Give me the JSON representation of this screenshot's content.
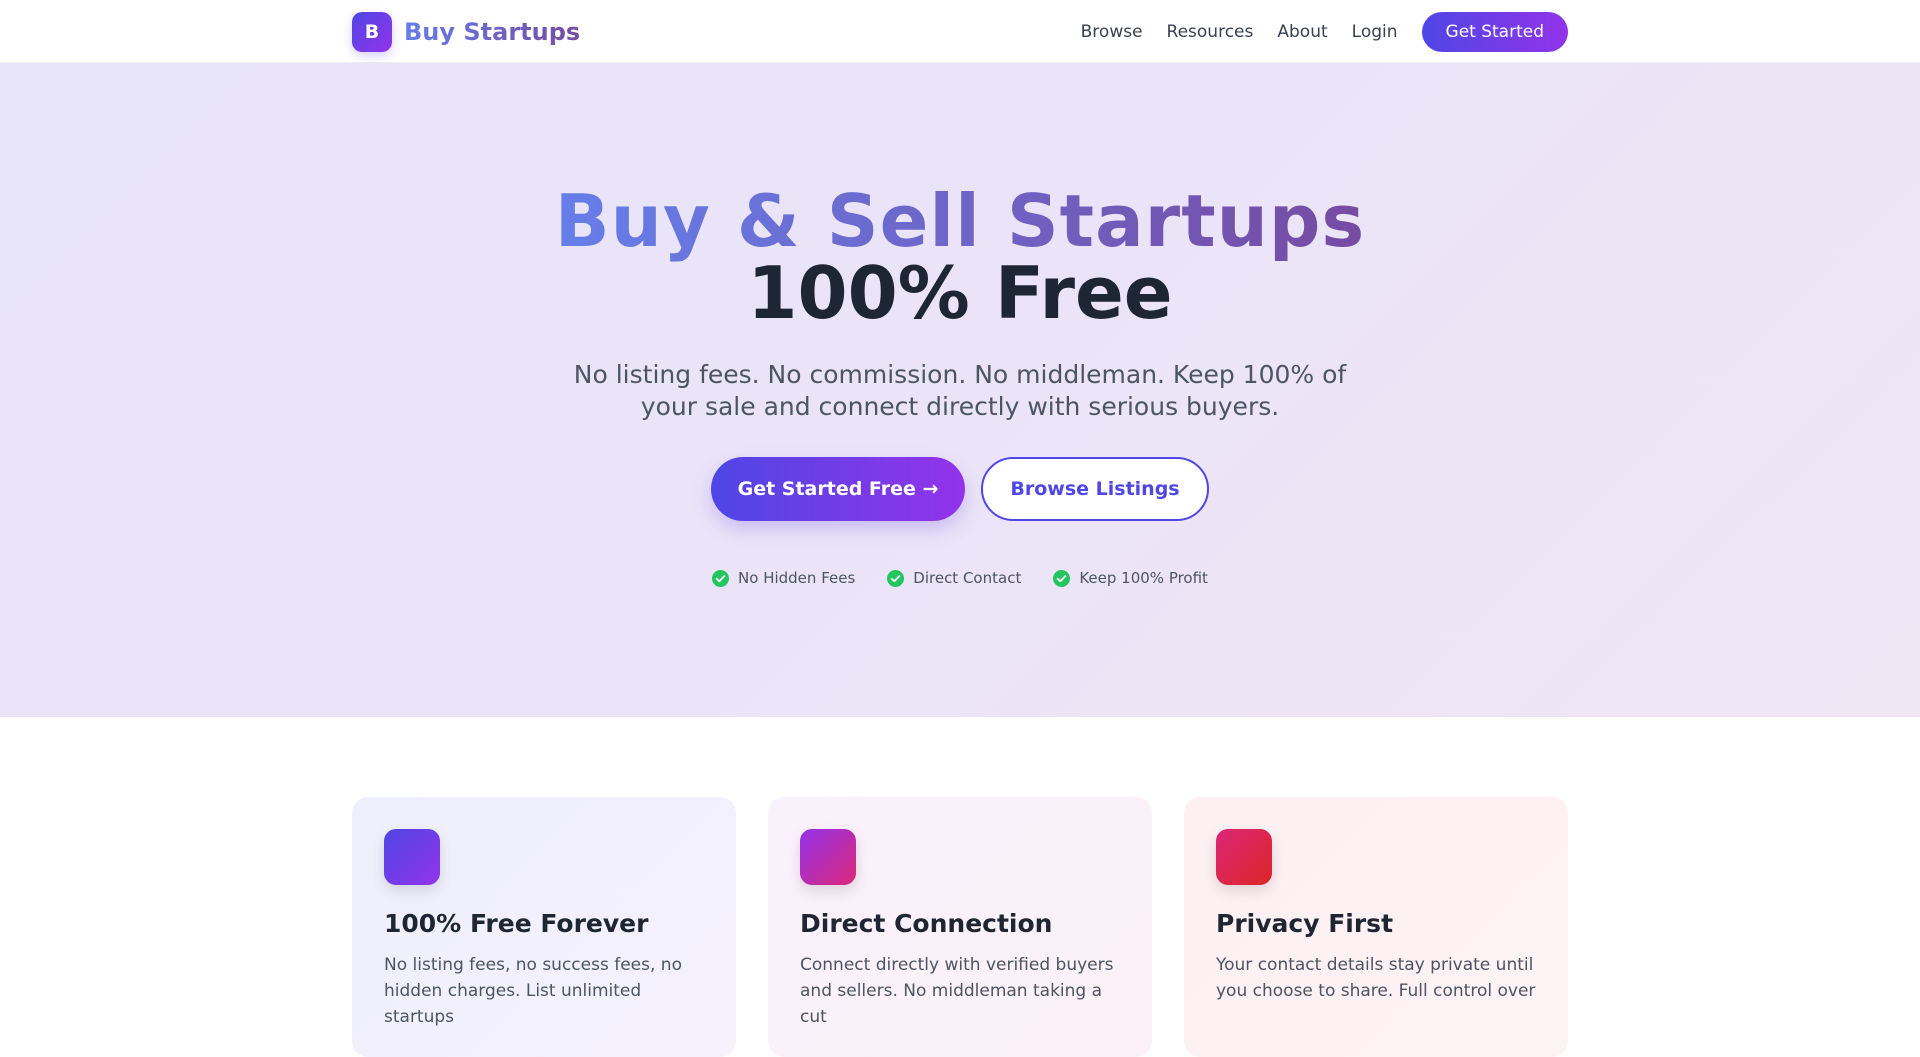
{
  "nav": {
    "logo_letter": "B",
    "brand_name": "Buy Startups",
    "links": [
      "Browse",
      "Resources",
      "About",
      "Login"
    ],
    "cta_label": "Get Started"
  },
  "hero": {
    "title_line1": "Buy & Sell Startups",
    "title_line2": "100% Free",
    "subtitle": "No listing fees. No commission. No middleman. Keep 100% of your sale and connect directly with serious buyers.",
    "primary_button": "Get Started Free →",
    "secondary_button": "Browse Listings",
    "badges": [
      "No Hidden Fees",
      "Direct Contact",
      "Keep 100% Profit"
    ]
  },
  "features": [
    {
      "icon": "gift-icon",
      "icon_glyph": "",
      "title": "100% Free Forever",
      "text": "No listing fees, no success fees, no hidden charges. List unlimited startups"
    },
    {
      "icon": "handshake-icon",
      "icon_glyph": "",
      "title": "Direct Connection",
      "text": "Connect directly with verified buyers and sellers. No middleman taking a cut"
    },
    {
      "icon": "lock-icon",
      "icon_glyph": "",
      "title": "Privacy First",
      "text": "Your contact details stay private until you choose to share. Full control over"
    }
  ],
  "colors": {
    "brand_start": "#4f46e5",
    "brand_end": "#9333ea",
    "check_green": "#22c55e",
    "heading_dark": "#1e2533"
  }
}
